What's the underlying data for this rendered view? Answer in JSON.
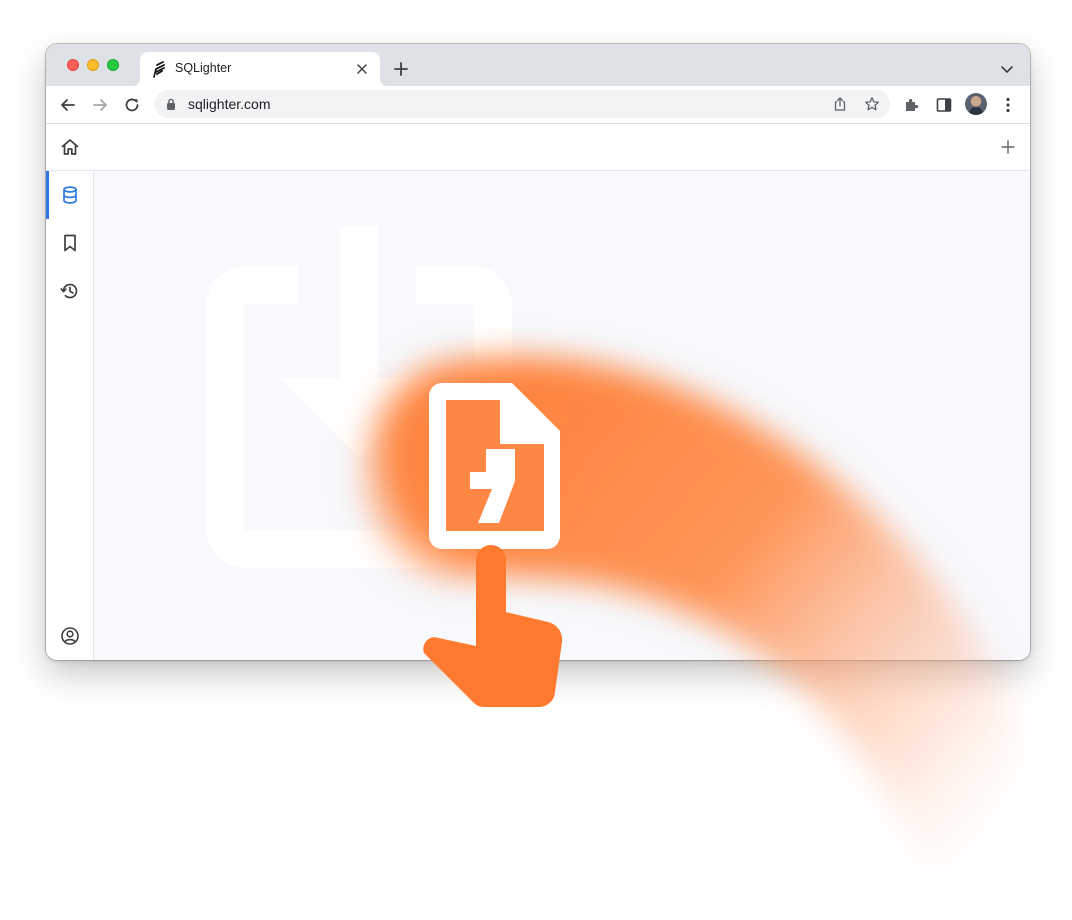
{
  "browser": {
    "tab": {
      "title": "SQLighter"
    },
    "address_bar": {
      "url": "sqlighter.com"
    }
  },
  "app": {
    "sidebar": {
      "items": [
        {
          "icon": "database-icon",
          "active": true
        },
        {
          "icon": "bookmark-icon",
          "active": false
        },
        {
          "icon": "history-icon",
          "active": false
        }
      ],
      "footer_icon": "user-account-icon"
    },
    "header": {
      "left_icon": "home-icon",
      "right_icon": "plus-icon"
    },
    "main": {
      "dropzone_icon": "file-download-icon"
    }
  },
  "overlay": {
    "dragged_file_icon": "sqlite-file-icon",
    "pointer_icon": "hand-pointer-icon",
    "accent_color": "#ff7a2f"
  },
  "colors": {
    "tab_strip": "#dee1e6",
    "sidebar_active": "#2f7ae5",
    "content_background": "#f7f9fd"
  }
}
